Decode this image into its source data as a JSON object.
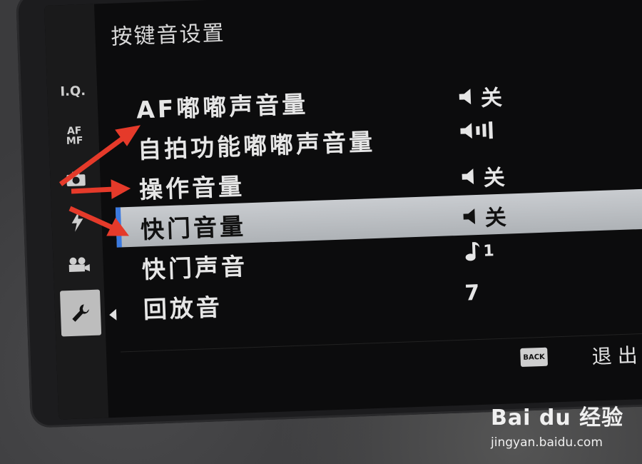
{
  "screen": {
    "title": "按键音设置",
    "tabs": [
      {
        "label": "I.Q."
      },
      {
        "label": "AF MF"
      },
      {
        "icon": "camera-icon"
      },
      {
        "icon": "flash-icon"
      },
      {
        "icon": "movie-icon"
      },
      {
        "icon": "wrench-icon",
        "active": true
      }
    ],
    "rows": [
      {
        "label": "AF嘟嘟声音量",
        "value": "关",
        "icon": "speaker-icon"
      },
      {
        "label": "自拍功能嘟嘟声音量",
        "value": "",
        "icon": "speaker-volume-icon"
      },
      {
        "label": "操作音量",
        "value": "关",
        "icon": "speaker-icon"
      },
      {
        "label": "快门音量",
        "value": "关",
        "icon": "speaker-icon",
        "selected": true
      },
      {
        "label": "快门声音",
        "value": "1",
        "icon": "music-note-icon"
      },
      {
        "label": "回放音",
        "value": "7"
      }
    ],
    "bottom": {
      "back_label": "BACK",
      "exit_label": "退出"
    }
  },
  "watermark": {
    "brand": "Bai du 经验",
    "sub": "jingyan.baidu.com"
  },
  "colors": {
    "selection_bg": "#c9ccd0",
    "selection_marker": "#3b7ae0",
    "annotation_arrow": "#e53a2a"
  }
}
